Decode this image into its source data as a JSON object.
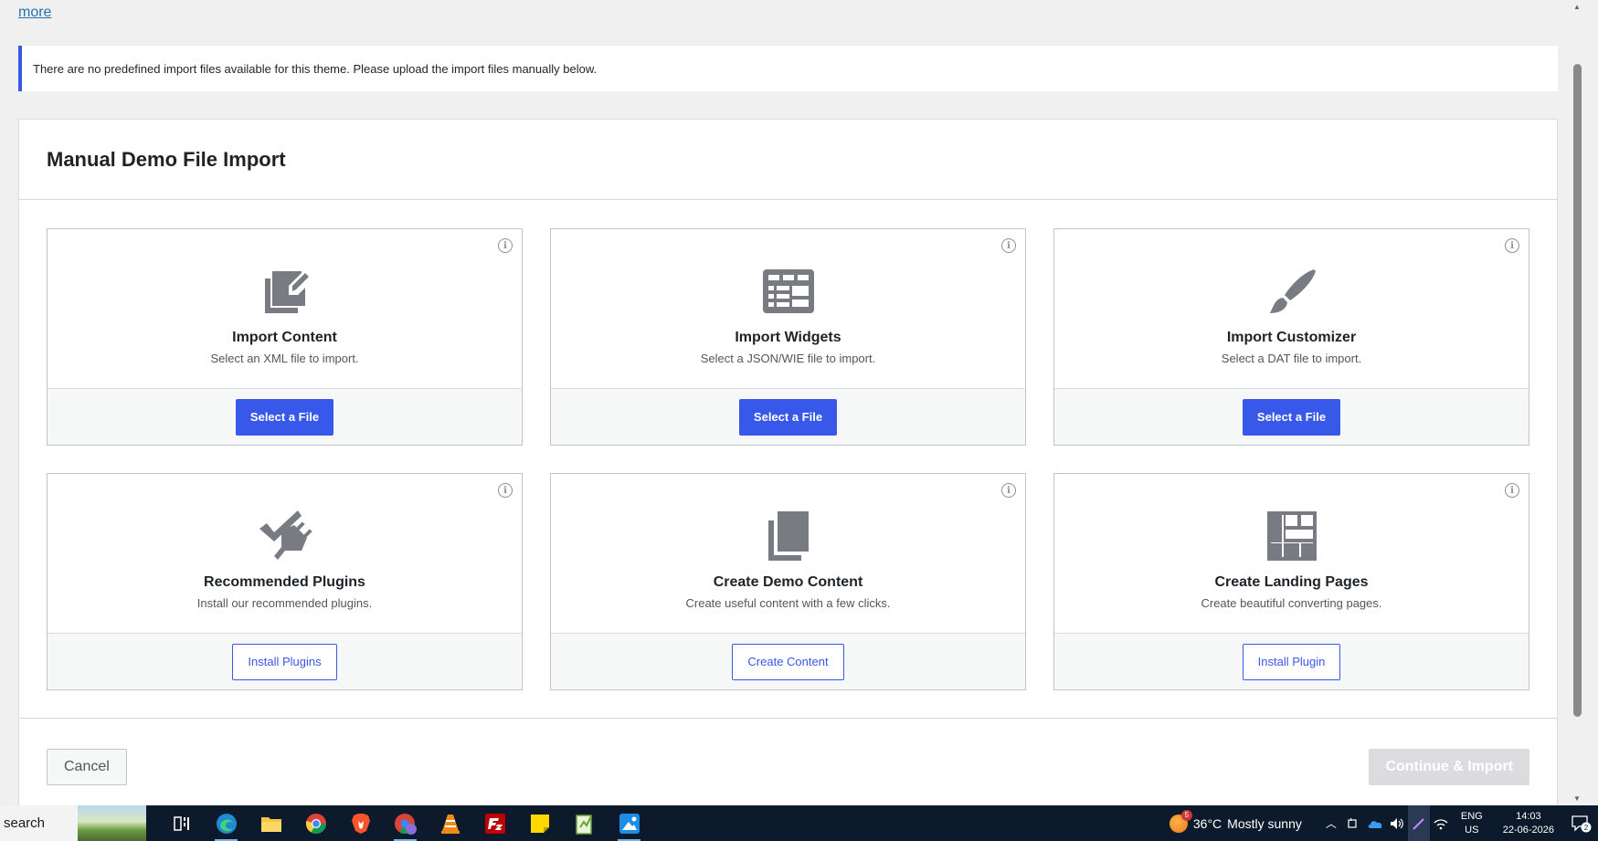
{
  "top_link": {
    "label": "more"
  },
  "notice": {
    "text": "There are no predefined import files available for this theme. Please upload the import files manually below."
  },
  "panel": {
    "title": "Manual Demo File Import"
  },
  "cards": [
    {
      "title": "Import Content",
      "description": "Select an XML file to import.",
      "button": "Select a File",
      "icon": "edit-document-icon"
    },
    {
      "title": "Import Widgets",
      "description": "Select a JSON/WIE file to import.",
      "button": "Select a File",
      "icon": "widgets-table-icon"
    },
    {
      "title": "Import Customizer",
      "description": "Select a DAT file to import.",
      "button": "Select a File",
      "icon": "paintbrush-icon"
    },
    {
      "title": "Recommended Plugins",
      "description": "Install our recommended plugins.",
      "button": "Install Plugins",
      "icon": "plugin-icon"
    },
    {
      "title": "Create Demo Content",
      "description": "Create useful content with a few clicks.",
      "button": "Create Content",
      "icon": "pages-icon"
    },
    {
      "title": "Create Landing Pages",
      "description": "Create beautiful converting pages.",
      "button": "Install Plugin",
      "icon": "layout-icon"
    }
  ],
  "info_glyph": "i",
  "footer": {
    "cancel": "Cancel",
    "continue": "Continue & Import"
  },
  "taskbar": {
    "search": "search",
    "weather": {
      "temp": "36°C",
      "condition": "Mostly sunny",
      "badge": "5"
    },
    "language": {
      "line1": "ENG",
      "line2": "US"
    },
    "clock": {
      "time": "14:03",
      "date": "22-06-2026"
    },
    "notifications": "2"
  },
  "colors": {
    "accent": "#3858e9",
    "disabled": "#dcdcde",
    "taskbar": "#0d1a2c"
  }
}
